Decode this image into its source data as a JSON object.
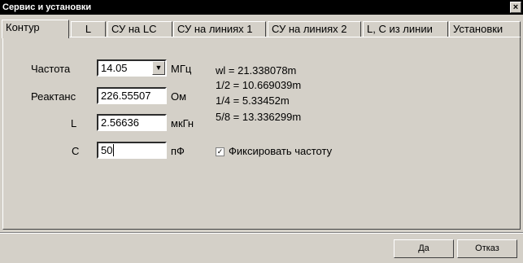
{
  "window": {
    "title": "Сервис и установки",
    "close_glyph": "×"
  },
  "tabs": [
    {
      "label": "Контур"
    },
    {
      "label": "L"
    },
    {
      "label": "СУ на LC"
    },
    {
      "label": "СУ на линиях 1"
    },
    {
      "label": "СУ на линиях 2"
    },
    {
      "label": "L, C из линии"
    },
    {
      "label": "Установки"
    }
  ],
  "form": {
    "freq": {
      "label": "Частота",
      "value": "14.05",
      "unit": "МГц"
    },
    "react": {
      "label": "Реактанс",
      "value": "226.55507",
      "unit": "Ом"
    },
    "L": {
      "label": "L",
      "value": "2.56636",
      "unit": "мкГн"
    },
    "C": {
      "label": "C",
      "value": "50",
      "unit": "пФ"
    },
    "fix_freq": {
      "label": "Фиксировать частоту",
      "checked": true
    }
  },
  "results": {
    "wl": "wl  = 21.338078m",
    "half": "1/2 = 10.669039m",
    "quarter": "1/4 = 5.33452m",
    "five_eighths": "5/8 = 13.336299m"
  },
  "buttons": {
    "ok": "Да",
    "cancel": "Отказ"
  },
  "icons": {
    "combo_arrow": "chevron-down-icon",
    "check": "check-icon"
  }
}
